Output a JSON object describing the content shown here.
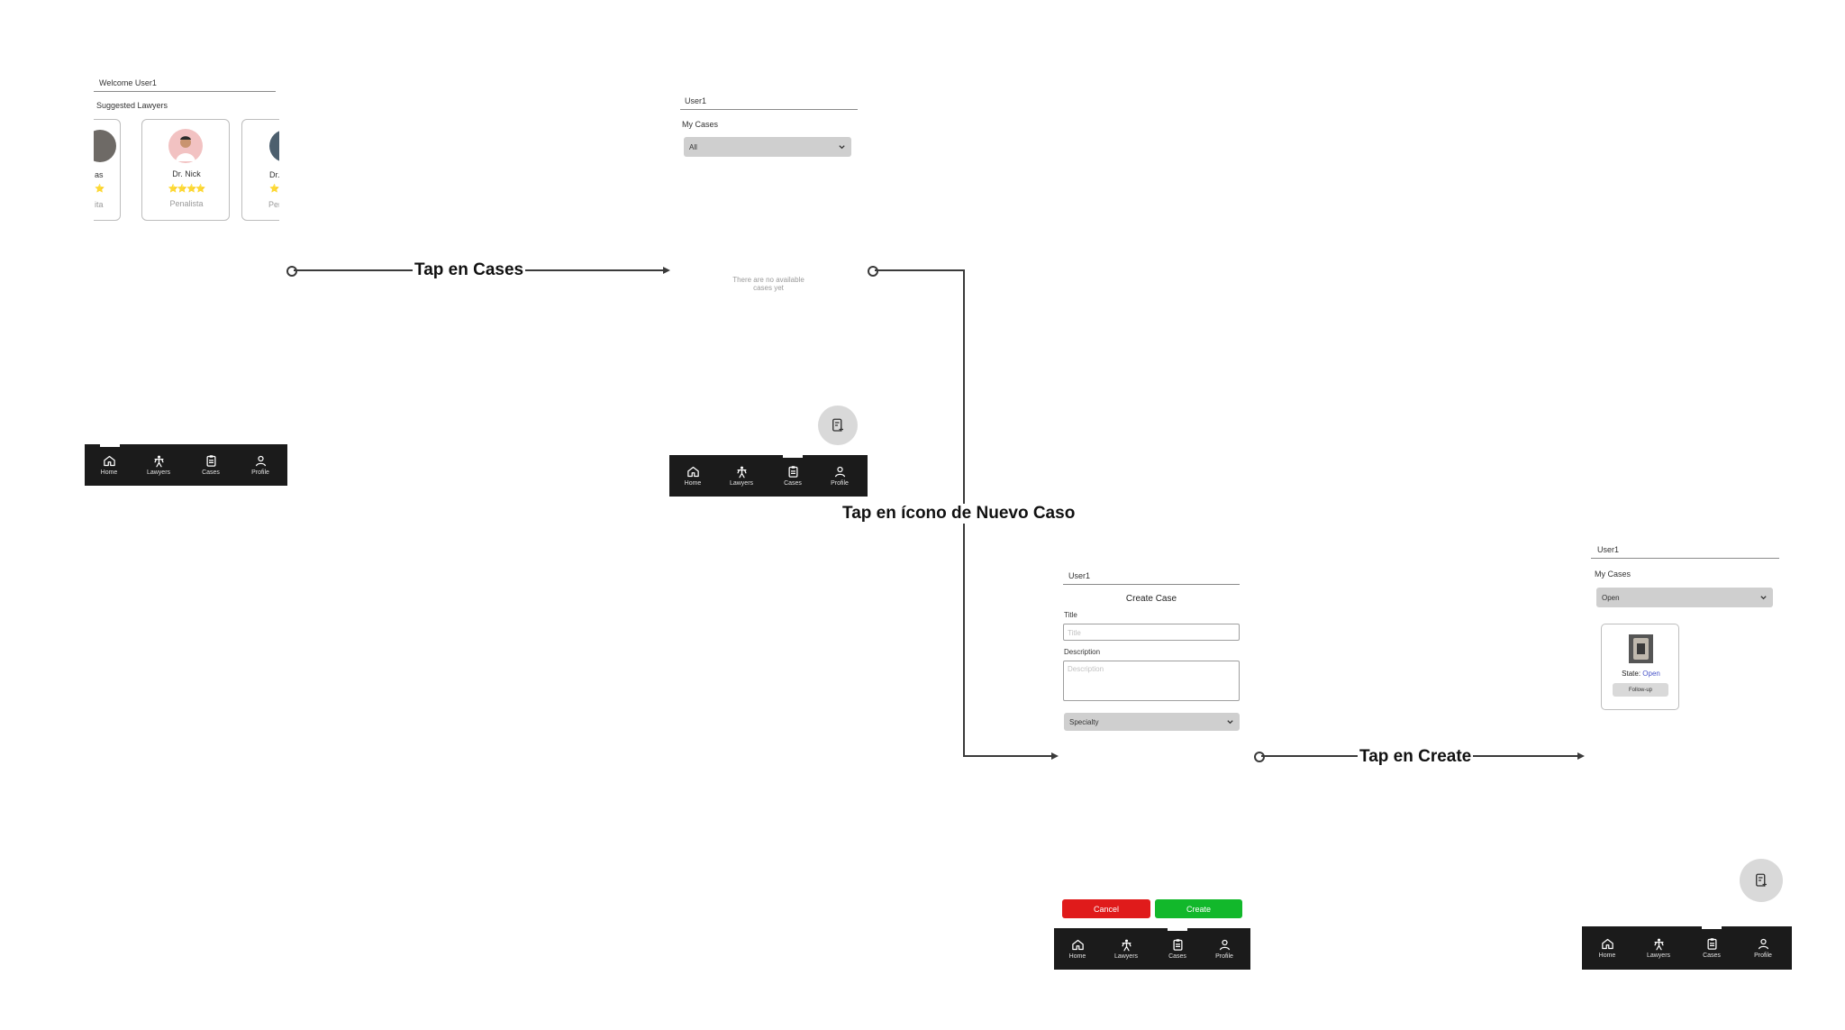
{
  "icons": {
    "home": "home-icon",
    "lawyers": "lawyer-icon",
    "cases": "clipboard-icon",
    "profile": "user-icon",
    "new_case": "new-case-icon",
    "chevron": "chevron-down-icon"
  },
  "colors": {
    "nav_bg": "#1b1b1b",
    "cancel": "#e01b1b",
    "create": "#12b82b",
    "stars": "#f0b400",
    "state_open": "#4a56c9"
  },
  "nav": {
    "home": "Home",
    "lawyers": "Lawyers",
    "cases": "Cases",
    "profile": "Profile"
  },
  "screen_home": {
    "welcome": "Welcome User1",
    "suggested_title": "Suggested Lawyers",
    "cards": [
      {
        "name": "as",
        "stars": "⭐",
        "specialty": "ita"
      },
      {
        "name": "Dr. Nick",
        "stars": "⭐⭐⭐⭐",
        "specialty": "Penalista"
      },
      {
        "name": "Dr.",
        "stars": "⭐",
        "specialty": "Pen"
      }
    ]
  },
  "screen_cases_empty": {
    "user": "User1",
    "title": "My Cases",
    "filter_value": "All",
    "empty_message": "There are no available cases yet"
  },
  "screen_create": {
    "user": "User1",
    "heading": "Create Case",
    "title_label": "Title",
    "title_placeholder": "Title",
    "description_label": "Description",
    "description_placeholder": "Description",
    "specialty_value": "Specialty",
    "cancel_label": "Cancel",
    "create_label": "Create"
  },
  "screen_cases_open": {
    "user": "User1",
    "title": "My Cases",
    "filter_value": "Open",
    "case": {
      "state_label": "State:",
      "state_value": "Open",
      "button_label": "Follow-up"
    }
  },
  "flow": {
    "tap_cases": "Tap en Cases",
    "tap_new_case": "Tap en ícono de Nuevo Caso",
    "tap_create": "Tap en Create"
  }
}
